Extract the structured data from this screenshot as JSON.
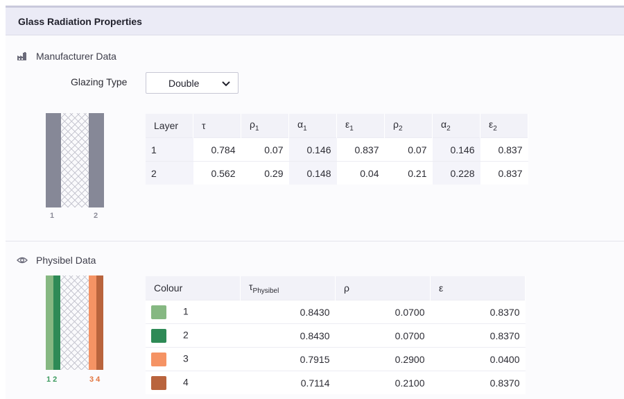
{
  "panel": {
    "title": "Glass Radiation Properties"
  },
  "manufacturer": {
    "heading": "Manufacturer Data",
    "heading_icon": "factory-icon",
    "glazing_label": "Glazing Type",
    "glazing_value": "Double",
    "diagram_labels": [
      "1",
      "2"
    ],
    "columns": [
      {
        "sym": "Layer",
        "sub": ""
      },
      {
        "sym": "τ",
        "sub": ""
      },
      {
        "sym": "ρ",
        "sub": "1"
      },
      {
        "sym": "α",
        "sub": "1"
      },
      {
        "sym": "ε",
        "sub": "1"
      },
      {
        "sym": "ρ",
        "sub": "2"
      },
      {
        "sym": "α",
        "sub": "2"
      },
      {
        "sym": "ε",
        "sub": "2"
      }
    ],
    "rows": [
      [
        "1",
        "0.784",
        "0.07",
        "0.146",
        "0.837",
        "0.07",
        "0.146",
        "0.837"
      ],
      [
        "2",
        "0.562",
        "0.29",
        "0.148",
        "0.04",
        "0.21",
        "0.228",
        "0.837"
      ]
    ]
  },
  "physibel": {
    "heading": "Physibel Data",
    "heading_icon": "eye-icon",
    "diagram_labels": {
      "left": "1 2",
      "right": "3 4"
    },
    "columns": [
      {
        "sym": "Colour",
        "sub": ""
      },
      {
        "sym": "τ",
        "sub": "Physibel"
      },
      {
        "sym": "ρ",
        "sub": ""
      },
      {
        "sym": "ε",
        "sub": ""
      }
    ],
    "rows": [
      {
        "color": "#86b882",
        "layer": "1",
        "tau": "0.8430",
        "rho": "0.0700",
        "eps": "0.8370"
      },
      {
        "color": "#2e8a56",
        "layer": "2",
        "tau": "0.8430",
        "rho": "0.0700",
        "eps": "0.8370"
      },
      {
        "color": "#f59364",
        "layer": "3",
        "tau": "0.7915",
        "rho": "0.2900",
        "eps": "0.0400"
      },
      {
        "color": "#b9643d",
        "layer": "4",
        "tau": "0.7114",
        "rho": "0.2100",
        "eps": "0.8370"
      }
    ]
  }
}
